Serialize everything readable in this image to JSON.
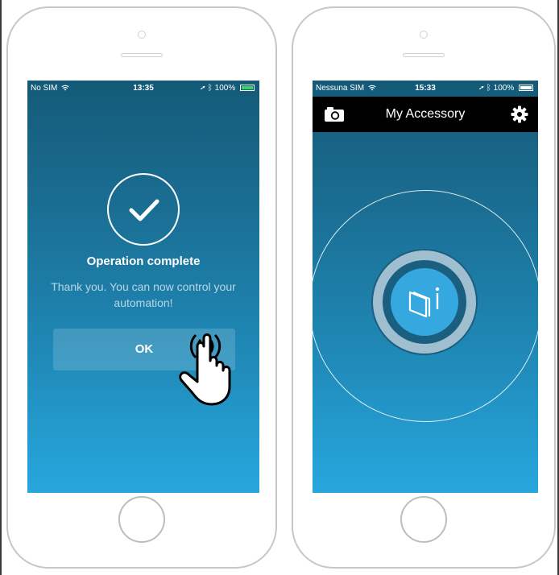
{
  "phone_left": {
    "status_bar": {
      "carrier": "No SIM",
      "time": "13:35",
      "battery": "100%",
      "battery_color": "#3cd35a"
    },
    "confirmation": {
      "title": "Operation complete",
      "message": "Thank you. You can now control your automation!",
      "ok_label": "OK",
      "icons": {
        "check": "checkmark-icon",
        "gesture": "tap-hand-icon"
      }
    }
  },
  "phone_right": {
    "status_bar": {
      "carrier": "Nessuna SIM",
      "time": "15:33",
      "battery": "100%"
    },
    "nav": {
      "title": "My Accessory",
      "left_icon": "camera-icon",
      "right_icon": "gear-icon"
    },
    "accessory_button": {
      "icon": "gate-info-icon",
      "accent": "#35a8e0"
    }
  },
  "colors": {
    "screen_top": "#145a78",
    "screen_bottom": "#27a7de",
    "nav_background": "#000000"
  }
}
